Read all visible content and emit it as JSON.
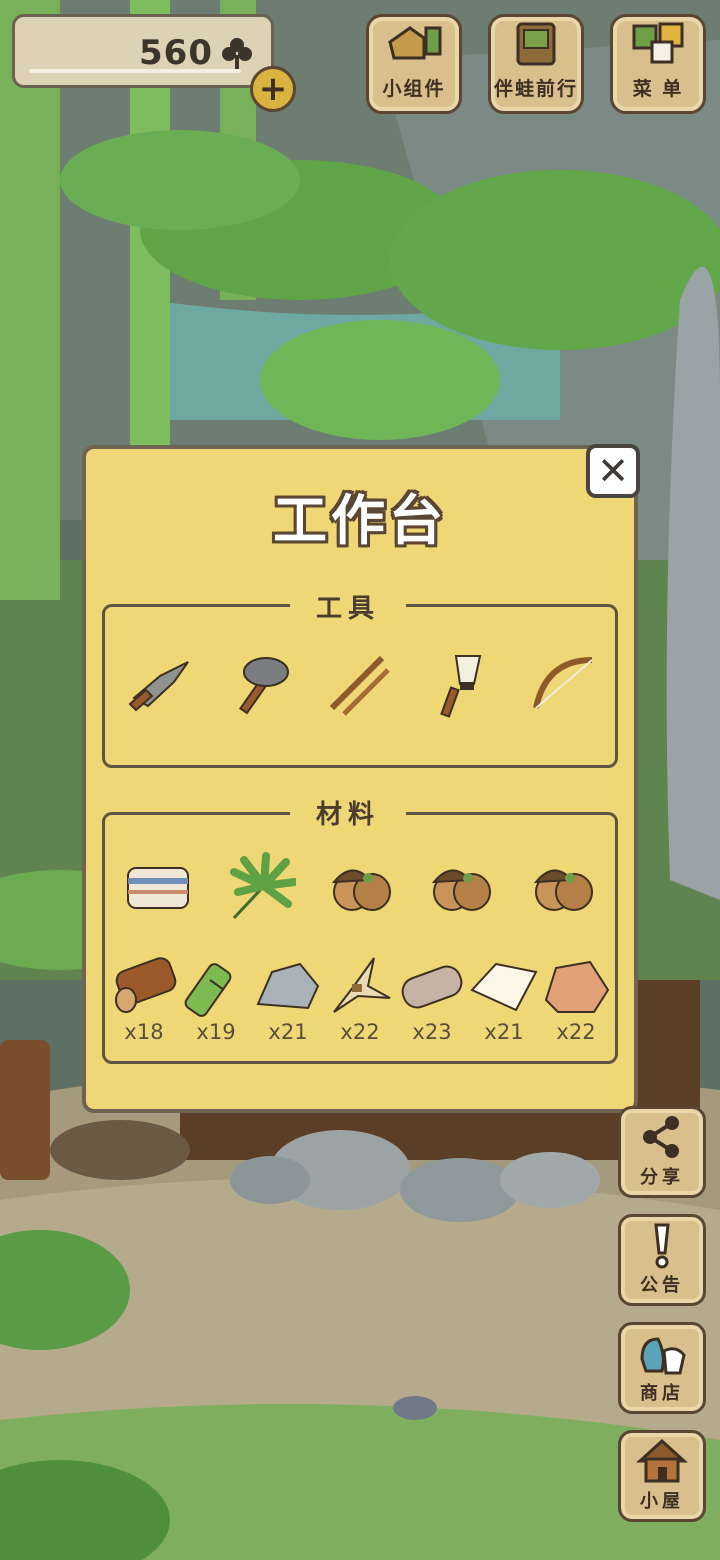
{
  "currency": {
    "amount": "560",
    "icon": "clover-icon"
  },
  "top_buttons": [
    {
      "label": "小组件",
      "icon": "widget-icon"
    },
    {
      "label": "伴蛙前行",
      "icon": "frog-journey-icon"
    },
    {
      "label": "菜 单",
      "icon": "menu-icon"
    }
  ],
  "panel": {
    "title": "工作台",
    "tools_title": "工具",
    "materials_title": "材料",
    "tools": [
      "knife-icon",
      "stone-hammer-icon",
      "sticks-icon",
      "brush-icon",
      "bow-icon"
    ],
    "materials_row1": [
      "cloth-icon",
      "palm-leaf-icon",
      "acorn-icon",
      "acorn-icon",
      "acorn-icon"
    ],
    "materials_row2": [
      {
        "icon": "log-icon",
        "count": "x18"
      },
      {
        "icon": "bamboo-icon",
        "count": "x19"
      },
      {
        "icon": "stone-icon",
        "count": "x21"
      },
      {
        "icon": "straw-icon",
        "count": "x22"
      },
      {
        "icon": "fabric-roll-icon",
        "count": "x23"
      },
      {
        "icon": "paper-icon",
        "count": "x21"
      },
      {
        "icon": "clay-icon",
        "count": "x22"
      }
    ]
  },
  "side_buttons": [
    {
      "label": "分享",
      "icon": "share-icon"
    },
    {
      "label": "公告",
      "icon": "notice-icon"
    },
    {
      "label": "商店",
      "icon": "shop-icon"
    },
    {
      "label": "小屋",
      "icon": "house-icon"
    }
  ],
  "colors": {
    "panel": "#eed774",
    "border": "#5a4633",
    "button": "#d8bf8b"
  }
}
